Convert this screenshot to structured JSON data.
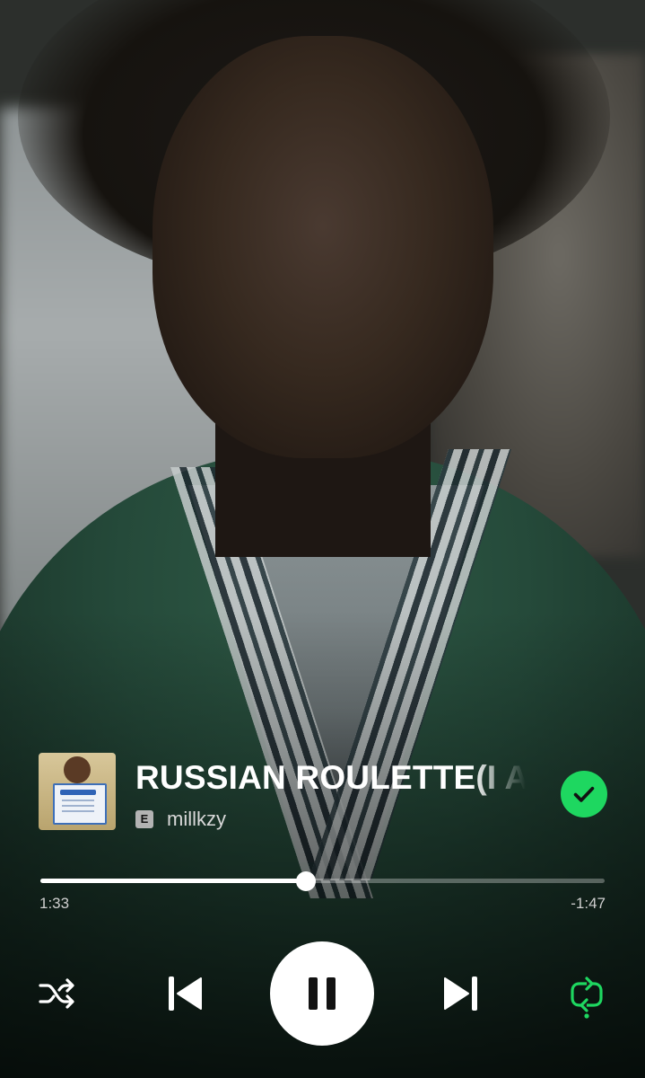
{
  "track": {
    "title": "RUSSIAN ROULETTE(I AM",
    "artist": "millkzy",
    "explicit_badge": "E",
    "liked": true
  },
  "playback": {
    "elapsed": "1:33",
    "remaining": "-1:47",
    "progress_fraction": 0.47,
    "state": "playing"
  },
  "controls": {
    "shuffle_icon": "shuffle-icon",
    "previous_icon": "skip-previous-icon",
    "play_pause_icon": "pause-icon",
    "next_icon": "skip-next-icon",
    "repeat_icon": "repeat-smart-icon"
  },
  "colors": {
    "accent": "#1ed760",
    "progress_fill": "#ffffff",
    "progress_track": "rgba(255,255,255,0.3)"
  }
}
